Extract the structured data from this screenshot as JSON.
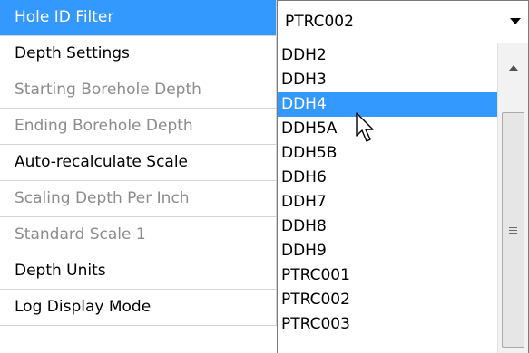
{
  "properties": [
    {
      "label": "Hole ID Filter",
      "state": "selected"
    },
    {
      "label": "Depth Settings",
      "state": "enabled"
    },
    {
      "label": "Starting Borehole Depth",
      "state": "disabled"
    },
    {
      "label": "Ending Borehole Depth",
      "state": "disabled"
    },
    {
      "label": "Auto-recalculate Scale",
      "state": "enabled"
    },
    {
      "label": "Scaling Depth Per Inch",
      "state": "disabled"
    },
    {
      "label": "Standard Scale 1",
      "state": "disabled"
    },
    {
      "label": "Depth Units",
      "state": "enabled"
    },
    {
      "label": "Log Display Mode",
      "state": "enabled"
    }
  ],
  "combo": {
    "value": "PTRC002",
    "arrow_icon": "chevron-down-icon"
  },
  "dropdown": {
    "hovered": "DDH4",
    "options": [
      "DDH2",
      "DDH3",
      "DDH4",
      "DDH5A",
      "DDH5B",
      "DDH6",
      "DDH7",
      "DDH8",
      "DDH9",
      "PTRC001",
      "PTRC002",
      "PTRC003"
    ]
  },
  "colors": {
    "selection": "#3399ff",
    "grid_line": "#d4d4d4",
    "disabled_text": "#8c8c8c"
  }
}
